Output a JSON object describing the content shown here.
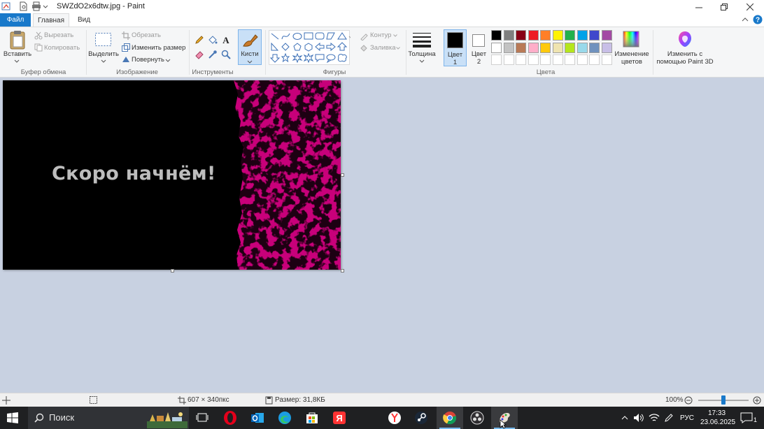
{
  "window": {
    "title": "SWZdO2x6dtw.jpg - Paint",
    "minimize_icon": "minimize-icon",
    "restore_icon": "restore-icon",
    "close_icon": "close-icon"
  },
  "menu": {
    "file": "Файл",
    "home": "Главная",
    "view": "Вид"
  },
  "ribbon": {
    "clipboard": {
      "group_label": "Буфер обмена",
      "paste": "Вставить",
      "cut": "Вырезать",
      "copy": "Копировать"
    },
    "image": {
      "group_label": "Изображение",
      "select": "Выделить",
      "crop": "Обрезать",
      "resize": "Изменить размер",
      "rotate": "Повернуть"
    },
    "tools": {
      "group_label": "Инструменты",
      "brushes": "Кисти"
    },
    "shapes": {
      "group_label": "Фигуры",
      "outline": "Контур",
      "fill": "Заливка"
    },
    "size": {
      "label": "Толщина"
    },
    "colors": {
      "group_label": "Цвета",
      "color1_line1": "Цвет",
      "color1_line2": "1",
      "color2_line1": "Цвет",
      "color2_line2": "2",
      "color1_value": "#000000",
      "color2_value": "#ffffff",
      "palette_row1": [
        "#000000",
        "#7f7f7f",
        "#880015",
        "#ed1c24",
        "#ff7f27",
        "#fff200",
        "#22b14c",
        "#00a2e8",
        "#3f48cc",
        "#a349a4"
      ],
      "palette_row2": [
        "#ffffff",
        "#c3c3c3",
        "#b97a57",
        "#ffaec9",
        "#ffc90e",
        "#efe4b0",
        "#b5e61d",
        "#99d9ea",
        "#7092be",
        "#c8bfe7"
      ],
      "edit_colors_line1": "Изменение",
      "edit_colors_line2": "цветов",
      "paint3d_line1": "Изменить с",
      "paint3d_line2": "помощью Paint 3D"
    }
  },
  "canvas": {
    "text": "Скоро начнём!",
    "bg_left": "#000000",
    "bg_right": "#c8007a"
  },
  "status": {
    "dimensions": "607 × 340пкс",
    "file_size": "Размер: 31,8КБ",
    "zoom": "100%",
    "zoom_level": 0.5
  },
  "taskbar": {
    "search_placeholder": "Поиск",
    "language": "РУС",
    "time": "17:33",
    "date": "23.06.2025",
    "notifications_count": "1"
  }
}
